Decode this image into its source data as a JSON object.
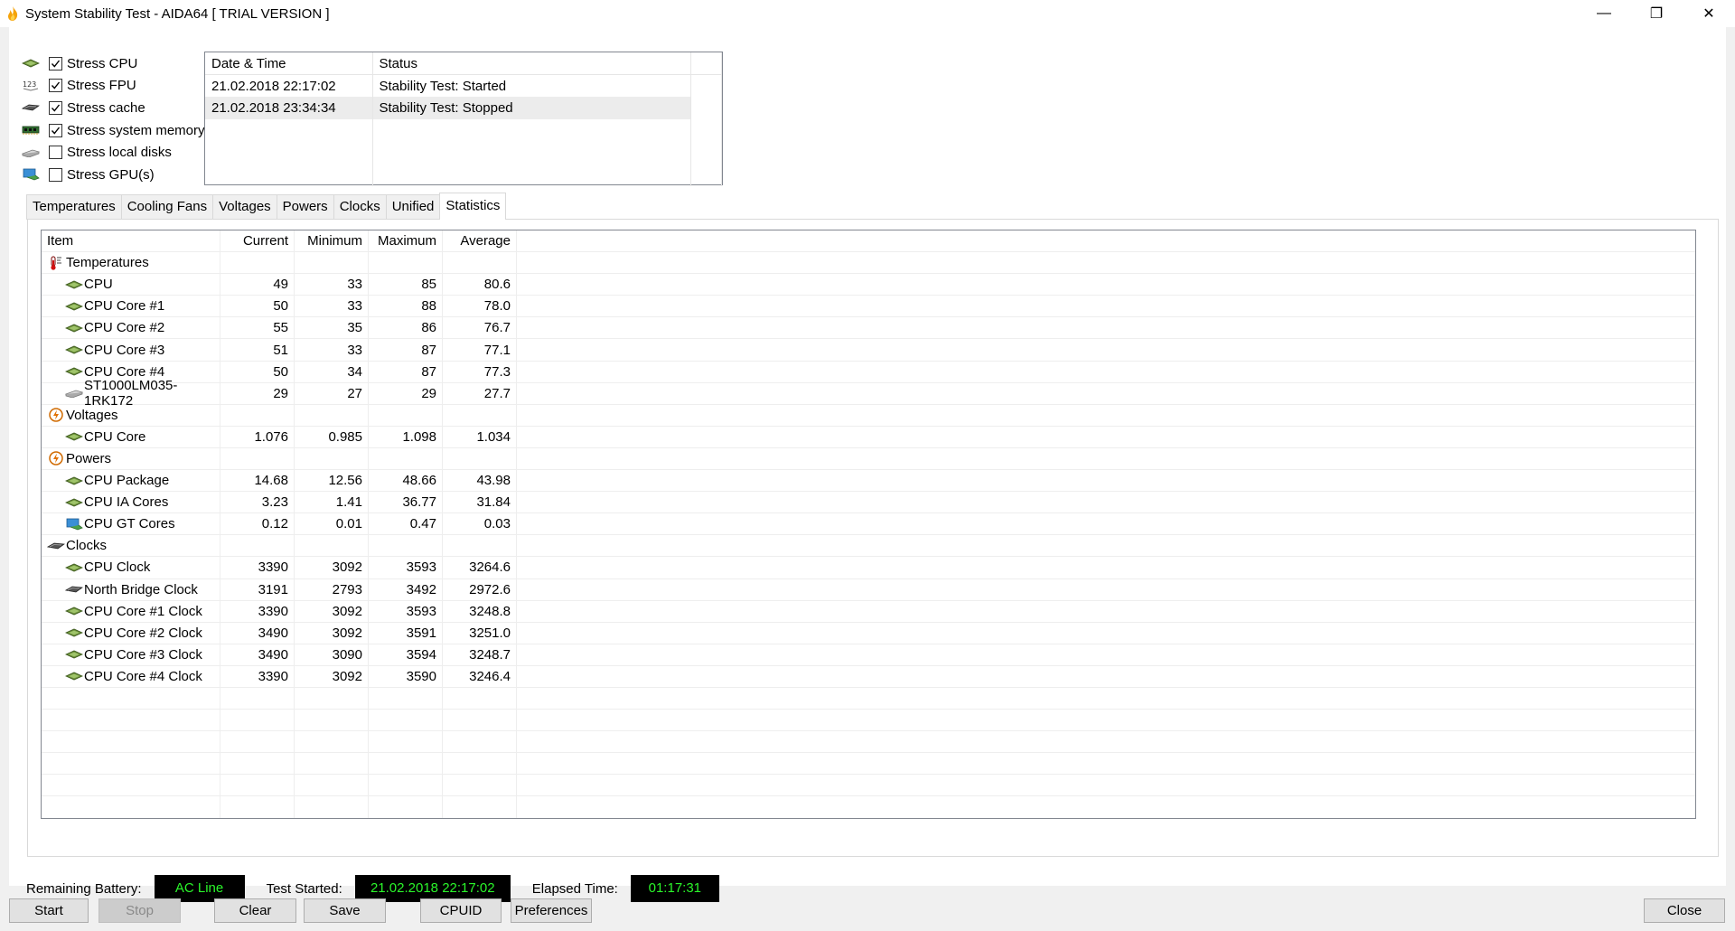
{
  "window": {
    "title": "System Stability Test - AIDA64  [ TRIAL VERSION ]",
    "minimize": "—",
    "restore": "❐",
    "close": "✕"
  },
  "stress_options": [
    {
      "label": "Stress CPU",
      "checked": true,
      "icon": "cpu-icon"
    },
    {
      "label": "Stress FPU",
      "checked": true,
      "icon": "fpu-icon"
    },
    {
      "label": "Stress cache",
      "checked": true,
      "icon": "cache-icon"
    },
    {
      "label": "Stress system memory",
      "checked": true,
      "icon": "memory-icon"
    },
    {
      "label": "Stress local disks",
      "checked": false,
      "icon": "disk-icon"
    },
    {
      "label": "Stress GPU(s)",
      "checked": false,
      "icon": "gpu-icon"
    }
  ],
  "log": {
    "headers": [
      "Date & Time",
      "Status"
    ],
    "rows": [
      [
        "21.02.2018 22:17:02",
        "Stability Test: Started"
      ],
      [
        "21.02.2018 23:34:34",
        "Stability Test: Stopped"
      ]
    ]
  },
  "tabs": [
    "Temperatures",
    "Cooling Fans",
    "Voltages",
    "Powers",
    "Clocks",
    "Unified",
    "Statistics"
  ],
  "active_tab": "Statistics",
  "stats": {
    "headers": [
      "Item",
      "Current",
      "Minimum",
      "Maximum",
      "Average"
    ],
    "rows": [
      {
        "type": "group",
        "label": "Temperatures",
        "icon": "thermometer-icon"
      },
      {
        "type": "item",
        "label": "CPU",
        "icon": "cpu-icon",
        "values": [
          "49",
          "33",
          "85",
          "80.6"
        ]
      },
      {
        "type": "item",
        "label": "CPU Core #1",
        "icon": "cpu-icon",
        "values": [
          "50",
          "33",
          "88",
          "78.0"
        ]
      },
      {
        "type": "item",
        "label": "CPU Core #2",
        "icon": "cpu-icon",
        "values": [
          "55",
          "35",
          "86",
          "76.7"
        ]
      },
      {
        "type": "item",
        "label": "CPU Core #3",
        "icon": "cpu-icon",
        "values": [
          "51",
          "33",
          "87",
          "77.1"
        ]
      },
      {
        "type": "item",
        "label": "CPU Core #4",
        "icon": "cpu-icon",
        "values": [
          "50",
          "34",
          "87",
          "77.3"
        ]
      },
      {
        "type": "item",
        "label": "ST1000LM035-1RK172",
        "icon": "disk-icon",
        "values": [
          "29",
          "27",
          "29",
          "27.7"
        ]
      },
      {
        "type": "group",
        "label": "Voltages",
        "icon": "lightning-icon"
      },
      {
        "type": "item",
        "label": "CPU Core",
        "icon": "cpu-icon",
        "values": [
          "1.076",
          "0.985",
          "1.098",
          "1.034"
        ]
      },
      {
        "type": "group",
        "label": "Powers",
        "icon": "lightning-icon"
      },
      {
        "type": "item",
        "label": "CPU Package",
        "icon": "cpu-icon",
        "values": [
          "14.68",
          "12.56",
          "48.66",
          "43.98"
        ]
      },
      {
        "type": "item",
        "label": "CPU IA Cores",
        "icon": "cpu-icon",
        "values": [
          "3.23",
          "1.41",
          "36.77",
          "31.84"
        ]
      },
      {
        "type": "item",
        "label": "CPU GT Cores",
        "icon": "gpu-icon",
        "values": [
          "0.12",
          "0.01",
          "0.47",
          "0.03"
        ]
      },
      {
        "type": "group",
        "label": "Clocks",
        "icon": "cache-icon"
      },
      {
        "type": "item",
        "label": "CPU Clock",
        "icon": "cpu-icon",
        "values": [
          "3390",
          "3092",
          "3593",
          "3264.6"
        ]
      },
      {
        "type": "item",
        "label": "North Bridge Clock",
        "icon": "cache-icon",
        "values": [
          "3191",
          "2793",
          "3492",
          "2972.6"
        ]
      },
      {
        "type": "item",
        "label": "CPU Core #1 Clock",
        "icon": "cpu-icon",
        "values": [
          "3390",
          "3092",
          "3593",
          "3248.8"
        ]
      },
      {
        "type": "item",
        "label": "CPU Core #2 Clock",
        "icon": "cpu-icon",
        "values": [
          "3490",
          "3092",
          "3591",
          "3251.0"
        ]
      },
      {
        "type": "item",
        "label": "CPU Core #3 Clock",
        "icon": "cpu-icon",
        "values": [
          "3490",
          "3090",
          "3594",
          "3248.7"
        ]
      },
      {
        "type": "item",
        "label": "CPU Core #4 Clock",
        "icon": "cpu-icon",
        "values": [
          "3390",
          "3092",
          "3590",
          "3246.4"
        ]
      }
    ]
  },
  "status": {
    "battery_label": "Remaining Battery:",
    "battery_value": "AC Line",
    "started_label": "Test Started:",
    "started_value": "21.02.2018 22:17:02",
    "elapsed_label": "Elapsed Time:",
    "elapsed_value": "01:17:31",
    "value_color": "#2af52a"
  },
  "buttons": {
    "start": "Start",
    "stop": "Stop",
    "clear": "Clear",
    "save": "Save",
    "cpuid": "CPUID",
    "preferences": "Preferences",
    "close": "Close"
  }
}
